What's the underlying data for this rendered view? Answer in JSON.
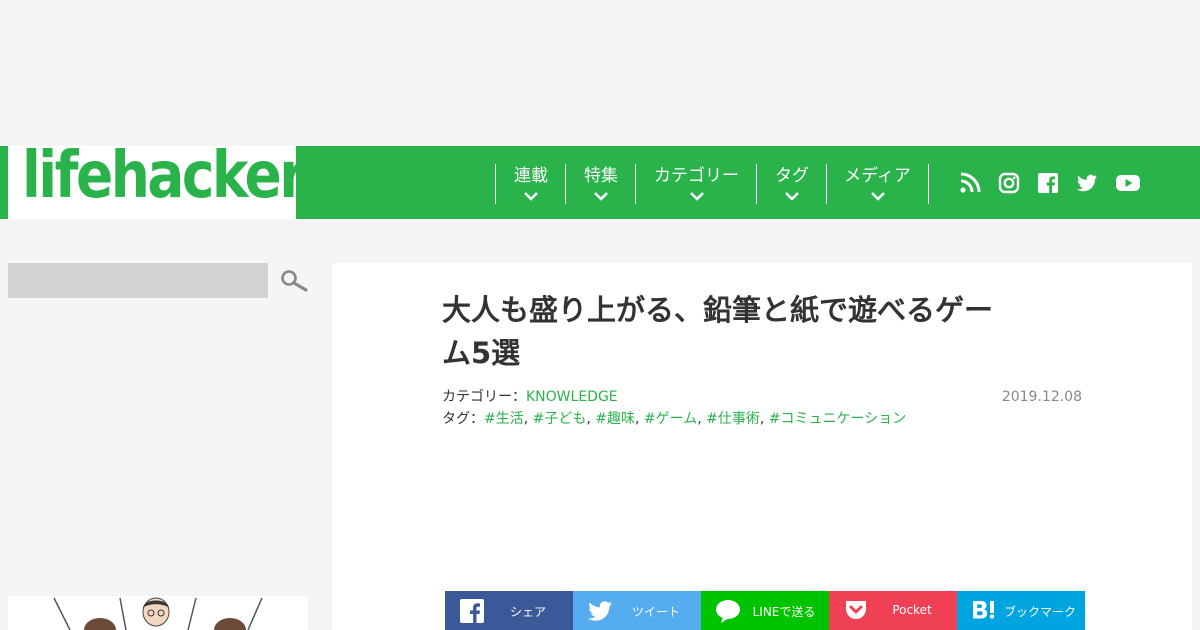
{
  "logo": {
    "text": "lifehacker"
  },
  "nav": {
    "items": [
      {
        "label": "連載"
      },
      {
        "label": "特集"
      },
      {
        "label": "カテゴリー"
      },
      {
        "label": "タグ"
      },
      {
        "label": "メディア"
      }
    ],
    "social_icons": [
      "rss-icon",
      "instagram-icon",
      "facebook-icon",
      "twitter-icon",
      "youtube-icon"
    ]
  },
  "search": {
    "value": "",
    "icon": "search-icon"
  },
  "article": {
    "title_line1": "大人も盛り上がる、鉛筆と紙で遊べるゲー",
    "title_line2": "ム5選",
    "category_label": "カテゴリー：",
    "category": "KNOWLEDGE",
    "tag_label": "タグ：",
    "tags": [
      "#生活",
      "#子ども",
      "#趣味",
      "#ゲーム",
      "#仕事術",
      "#コミュニケーション"
    ],
    "tag_separator": ",",
    "date": "2019.12.08"
  },
  "share": [
    {
      "label": "シェア",
      "icon": "facebook-icon",
      "color": "#3b5998"
    },
    {
      "label": "ツイート",
      "icon": "twitter-icon",
      "color": "#55acee"
    },
    {
      "label": "LINEで送る",
      "icon": "line-icon",
      "color": "#00c300"
    },
    {
      "label": "Pocket",
      "icon": "pocket-icon",
      "color": "#ef4056"
    },
    {
      "label": "ブックマーク",
      "icon": "hatena-bookmark-icon",
      "color": "#00a4de"
    }
  ],
  "colors": {
    "brand": "#2ab24b",
    "background": "#f5f5f5",
    "search_box": "#d2d2d2"
  }
}
